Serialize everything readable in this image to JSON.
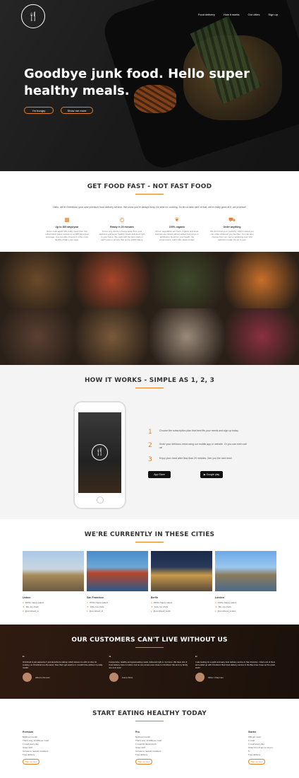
{
  "hero": {
    "logo_glyph": "🍴",
    "nav": [
      "Food delivery",
      "How it works",
      "Our cities",
      "Sign up"
    ],
    "title": "Goodbye junk food. Hello super healthy meals.",
    "btn_primary": "I'm hungry",
    "btn_secondary": "Show me more"
  },
  "features": {
    "heading": "GET FOOD FAST - NOT FAST FOOD",
    "copy": "Hello, we're Omnifood, your new premium food delivery service. We know you're always busy. No time for cooking. So let us take care of that, we're really good at it, we promise!",
    "items": [
      {
        "icon": "calendar-icon",
        "glyph": "▦",
        "title": "Up to 365 days/year",
        "text": "Never cook again! We really mean that. Our subscription plans include up to 365 days/year coverage. You can also choose to order more flexibly if that's your style."
      },
      {
        "icon": "clock-icon",
        "glyph": "◴",
        "title": "Ready in 20 minutes",
        "text": "You're only twenty minutes away from your delicious and super healthy meals delivered right to your home. We work with the best chefs in each town to ensure that you're 100% happy."
      },
      {
        "icon": "leaf-icon",
        "glyph": "❦",
        "title": "100% organic",
        "text": "All our vegetables are fresh, organic and local. Animals are raised without added hormones or antibiotics. Good for your health, the environment, and it also tastes better!"
      },
      {
        "icon": "cart-icon",
        "glyph": "⛟",
        "title": "Order anything",
        "text": "We don't limit your creativity, which means you can order whatever you feel like. You can also choose from our menu containing over 100 delicious meals. It's up to you!"
      }
    ]
  },
  "meals": {
    "colors": [
      "#6b4a2a",
      "#a8452a",
      "#3d4a2a",
      "#c8702a",
      "#5a4032",
      "#7a5a3a",
      "#9a8a7a",
      "#8a3040"
    ]
  },
  "how": {
    "heading": "HOW IT WORKS - SIMPLE AS 1, 2, 3",
    "steps": [
      {
        "num": "1",
        "text": "Choose the subscription plan that best fits your needs and sign up today."
      },
      {
        "num": "2",
        "text": "Order your delicious meal using our mobile app or website. Or you can even call us!"
      },
      {
        "num": "3",
        "text": "Enjoy your meal after less than 20 minutes. See you the next time!"
      }
    ],
    "appstore": " App Store",
    "playstore": "▶ Google play"
  },
  "cities": {
    "heading": "WE'RE CURRENTLY IN THESE CITIES",
    "items": [
      {
        "name": "Lisbon",
        "people": "1600+ happy eaters",
        "chefs": "60+ top chefs",
        "handle": "@omnifood_lx"
      },
      {
        "name": "San Francisco",
        "people": "3700+ happy eaters",
        "chefs": "160+ top chefs",
        "handle": "@omnifood_sf"
      },
      {
        "name": "Berlin",
        "people": "2300+ happy eaters",
        "chefs": "110+ top chefs",
        "handle": "@omnifood_berlin"
      },
      {
        "name": "London",
        "people": "1200+ happy eaters",
        "chefs": "50+ top chefs",
        "handle": "@omnifood_london"
      }
    ]
  },
  "testimonials": {
    "heading": "OUR CUSTOMERS CAN'T LIVE WITHOUT US",
    "items": [
      {
        "text": "Omnifood is just awesome! I just launched a startup which leaves me with no time for cooking, so Omnifood is a life-saver. Now that I got used to it, I couldn't live without my daily meals!",
        "name": "Alberto Duncan"
      },
      {
        "text": "Inexpensive, healthy and great-tasting meals, delivered right to my home. We have lots of food delivery here in Lisbon, but no one comes even close to Omnifood. Me and my family are so in love!",
        "name": "Joana Silva"
      },
      {
        "text": "I was looking for a quick and easy food delivery service in San Franciso. I tried a lot of them and ended up with Omnifood. Best food delivery service in the Bay Area. Keep up the great work!",
        "name": "Milton Chapman"
      }
    ]
  },
  "plans": {
    "heading": "START EATING HEALTHY TODAY",
    "items": [
      {
        "name": "Premium",
        "lines": [
          "$399 per month",
          "That's only 13.30$ per meal",
          "1 meal every day",
          "Order 24/7",
          "Access to newest creations",
          "Free delivery"
        ],
        "button": "Sign up now"
      },
      {
        "name": "Pro",
        "lines": [
          "$149 per month",
          "That's only 14.90$ per meal",
          "1 meal 10 days/month",
          "Order 24/7",
          "Access to newest creations",
          "Free delivery"
        ],
        "button": "Sign up now"
      },
      {
        "name": "Starter",
        "lines": [
          "19$ per meal",
          "1 meal",
          "1 meal every day",
          "Order from 8 am to 12 pm",
          "5",
          "Free delivery"
        ],
        "button": "Sign up now"
      }
    ]
  }
}
